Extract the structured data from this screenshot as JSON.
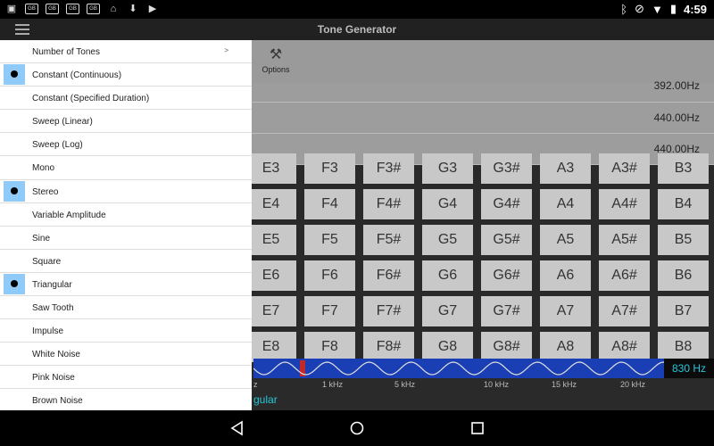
{
  "status_bar": {
    "time": "4:59",
    "left_icons": [
      "photo-icon",
      "gb-icon",
      "gb-icon",
      "gb-icon",
      "gb-icon",
      "android-icon",
      "download-icon",
      "play-store-icon"
    ],
    "right_icons": [
      "bluetooth-icon",
      "do-not-disturb-icon",
      "wifi-icon",
      "battery-icon"
    ]
  },
  "app": {
    "title": "Tone Generator"
  },
  "toolbar": {
    "options_label": "Options"
  },
  "frequencies": [
    "392.00Hz",
    "440.00Hz",
    "440.00Hz"
  ],
  "notes": [
    [
      "E3",
      "F3",
      "F3#",
      "G3",
      "G3#",
      "A3",
      "A3#",
      "B3"
    ],
    [
      "E4",
      "F4",
      "F4#",
      "G4",
      "G4#",
      "A4",
      "A4#",
      "B4"
    ],
    [
      "E5",
      "F5",
      "F5#",
      "G5",
      "G5#",
      "A5",
      "A5#",
      "B5"
    ],
    [
      "E6",
      "F6",
      "F6#",
      "G6",
      "G6#",
      "A6",
      "A6#",
      "B6"
    ],
    [
      "E7",
      "F7",
      "F7#",
      "G7",
      "G7#",
      "A7",
      "A7#",
      "B7"
    ],
    [
      "E8",
      "F8",
      "F8#",
      "G8",
      "G8#",
      "A8",
      "A8#",
      "B8"
    ]
  ],
  "wave": {
    "frequency": "830 Hz",
    "scale_labels": [
      "z",
      "1 kHz",
      "5 kHz",
      "10 kHz",
      "15 kHz",
      "20 kHz"
    ],
    "name_fragment": "gular"
  },
  "drawer": {
    "items": [
      {
        "label": "Number of Tones",
        "checked": false,
        "arrow": ">"
      },
      {
        "label": "Constant (Continuous)",
        "checked": true
      },
      {
        "label": "Constant (Specified Duration)",
        "checked": false
      },
      {
        "label": "Sweep (Linear)",
        "checked": false
      },
      {
        "label": "Sweep (Log)",
        "checked": false
      },
      {
        "label": "Mono",
        "checked": false
      },
      {
        "label": "Stereo",
        "checked": true
      },
      {
        "label": "Variable Amplitude",
        "checked": false
      },
      {
        "label": "Sine",
        "checked": false
      },
      {
        "label": "Square",
        "checked": false
      },
      {
        "label": "Triangular",
        "checked": true
      },
      {
        "label": "Saw Tooth",
        "checked": false
      },
      {
        "label": "Impulse",
        "checked": false
      },
      {
        "label": "White Noise",
        "checked": false
      },
      {
        "label": "Pink Noise",
        "checked": false
      },
      {
        "label": "Brown Noise",
        "checked": false
      }
    ]
  },
  "colors": {
    "accent": "#26c6da",
    "selected": "#90caf9",
    "wave_bg": "#1a3fb5"
  }
}
